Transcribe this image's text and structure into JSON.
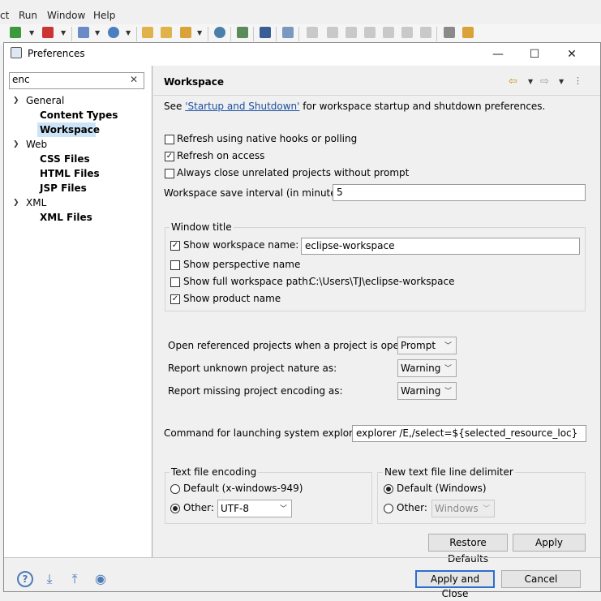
{
  "ide": {
    "menu": [
      "ct",
      "Run",
      "Window",
      "Help"
    ]
  },
  "window": {
    "title": "Preferences",
    "minimize": "—",
    "maximize": "☐",
    "close": "✕"
  },
  "filter": {
    "value": "enc"
  },
  "tree": {
    "general": {
      "label": "General",
      "children": [
        "Content Types",
        "Workspace"
      ]
    },
    "web": {
      "label": "Web",
      "children": [
        "CSS Files",
        "HTML Files",
        "JSP Files"
      ]
    },
    "xml": {
      "label": "XML",
      "children": [
        "XML Files"
      ]
    },
    "selected": "Workspace"
  },
  "page": {
    "title": "Workspace",
    "see_prefix": "See ",
    "see_link": "'Startup and Shutdown'",
    "see_suffix": " for workspace startup and shutdown preferences.",
    "options": [
      {
        "label": "Refresh using native hooks or polling",
        "checked": false
      },
      {
        "label": "Refresh on access",
        "checked": true
      },
      {
        "label": "Always close unrelated projects without prompt",
        "checked": false
      }
    ],
    "save_interval": {
      "label": "Workspace save interval (in minutes):",
      "value": "5"
    },
    "window_title": {
      "group": "Window title",
      "show_workspace_name": {
        "label": "Show workspace name:",
        "checked": true,
        "value": "eclipse-workspace"
      },
      "show_perspective_name": {
        "label": "Show perspective name",
        "checked": false
      },
      "show_full_path": {
        "label": "Show full workspace path:",
        "checked": false,
        "value": "C:\\Users\\TJ\\eclipse-workspace"
      },
      "show_product_name": {
        "label": "Show product name",
        "checked": true
      }
    },
    "combos": [
      {
        "label": "Open referenced projects when a project is opened:",
        "value": "Prompt"
      },
      {
        "label": "Report unknown project nature as:",
        "value": "Warning"
      },
      {
        "label": "Report missing project encoding as:",
        "value": "Warning"
      }
    ],
    "explorer": {
      "label": "Command for launching system explorer:",
      "value": "explorer /E,/select=${selected_resource_loc}"
    },
    "encoding": {
      "group": "Text file encoding",
      "default_label": "Default (x-windows-949)",
      "other_label": "Other:",
      "other_value": "UTF-8",
      "selected": "other"
    },
    "delimiter": {
      "group": "New text file line delimiter",
      "default_label": "Default (Windows)",
      "other_label": "Other:",
      "other_value": "Windows",
      "selected": "default"
    }
  },
  "buttons": {
    "restore_defaults": "Restore Defaults",
    "apply": "Apply",
    "apply_close": "Apply and Close",
    "cancel": "Cancel"
  },
  "footer_icons": [
    "help-icon",
    "import-icon",
    "export-icon",
    "record-icon"
  ],
  "colors": {
    "selection": "#cce4f7",
    "link": "#1a4fa0",
    "default_button_border": "#2b6fcf"
  }
}
